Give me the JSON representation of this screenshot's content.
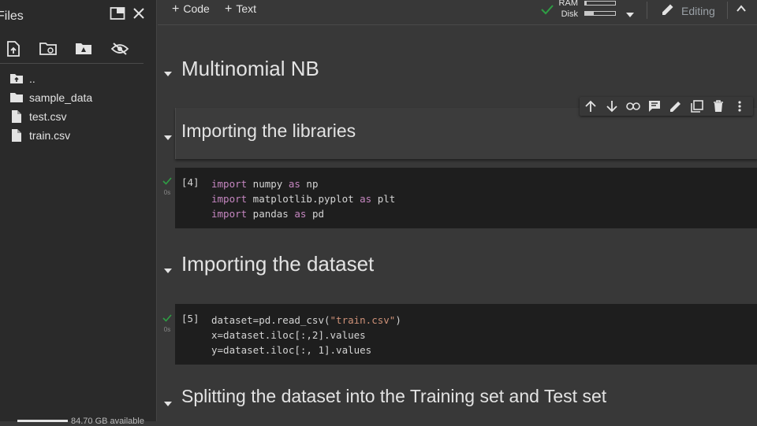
{
  "sidebar": {
    "title": "Files",
    "files": [
      {
        "name": "..",
        "icon": "folder-up-icon"
      },
      {
        "name": "sample_data",
        "icon": "folder-icon"
      },
      {
        "name": "test.csv",
        "icon": "file-icon"
      },
      {
        "name": "train.csv",
        "icon": "file-icon"
      }
    ],
    "disk_text": "84.70 GB available"
  },
  "topbar": {
    "add_code": "Code",
    "add_text": "Text",
    "ram_label": "RAM",
    "disk_label": "Disk",
    "ram_usage": 0.05,
    "disk_usage": 0.3,
    "editing_label": "Editing"
  },
  "notebook": {
    "heading1": "Multinomial NB",
    "heading2": "Importing the libraries",
    "cell1": {
      "exec": "[4]",
      "time": "0s",
      "lines": [
        [
          "import",
          " numpy ",
          "as",
          " np"
        ],
        [
          "import",
          " matplotlib.pyplot ",
          "as",
          " plt"
        ],
        [
          "import",
          " pandas ",
          "as",
          " pd"
        ]
      ]
    },
    "heading3": "Importing the dataset",
    "cell2": {
      "exec": "[5]",
      "time": "0s",
      "line1_prefix": "dataset=pd.read_csv(",
      "line1_string": "\"train.csv\"",
      "line1_suffix": ")",
      "line2": "x=dataset.iloc[:,2].values",
      "line3": "y=dataset.iloc[:, 1].values"
    },
    "heading4": "Splitting the dataset into the Training set and Test set"
  },
  "colors": {
    "keyword": "#c586c0",
    "string": "#ce9178",
    "check": "#2e9e44"
  }
}
